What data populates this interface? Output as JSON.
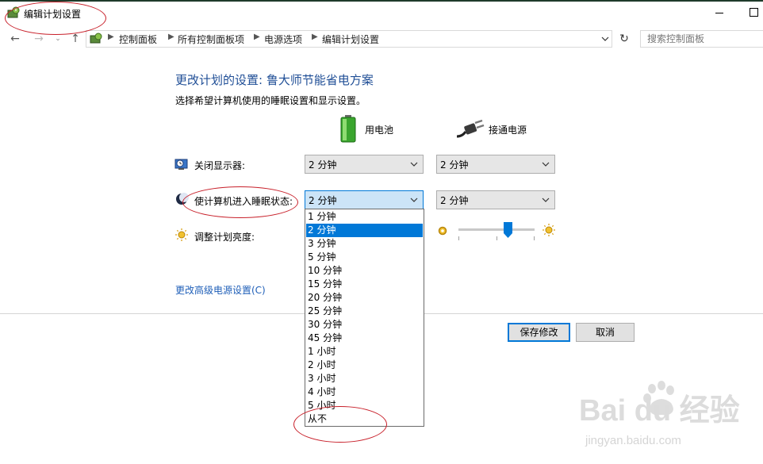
{
  "window": {
    "title": "编辑计划设置"
  },
  "address_bar": {
    "crumbs": [
      "控制面板",
      "所有控制面板项",
      "电源选项",
      "编辑计划设置"
    ],
    "search_placeholder": "搜索控制面板"
  },
  "page": {
    "heading": "更改计划的设置: 鲁大师节能省电方案",
    "subtitle": "选择希望计算机使用的睡眠设置和显示设置。",
    "columns": {
      "battery": "用电池",
      "plugged": "接通电源"
    },
    "rows": {
      "display_off": {
        "label": "关闭显示器:",
        "battery_value": "2 分钟",
        "plugged_value": "2 分钟"
      },
      "sleep": {
        "label": "使计算机进入睡眠状态:",
        "battery_value": "2 分钟",
        "plugged_value": "2 分钟"
      },
      "brightness": {
        "label": "调整计划亮度:",
        "plugged_level_percent": 65
      }
    },
    "dropdown_options": [
      "1 分钟",
      "2 分钟",
      "3 分钟",
      "5 分钟",
      "10 分钟",
      "15 分钟",
      "20 分钟",
      "25 分钟",
      "30 分钟",
      "45 分钟",
      "1 小时",
      "2 小时",
      "3 小时",
      "4 小时",
      "5 小时",
      "从不"
    ],
    "dropdown_selected": "2 分钟",
    "advanced_link": "更改高级电源设置(C)",
    "save_button": "保存修改",
    "cancel_button": "取消"
  },
  "watermark": {
    "brand": "Bai du 经验",
    "url": "jingyan.baidu.com"
  },
  "colors": {
    "accent": "#0078d7",
    "heading": "#1f4e96",
    "link": "#1f5fb8",
    "annotation": "#c8202a"
  }
}
